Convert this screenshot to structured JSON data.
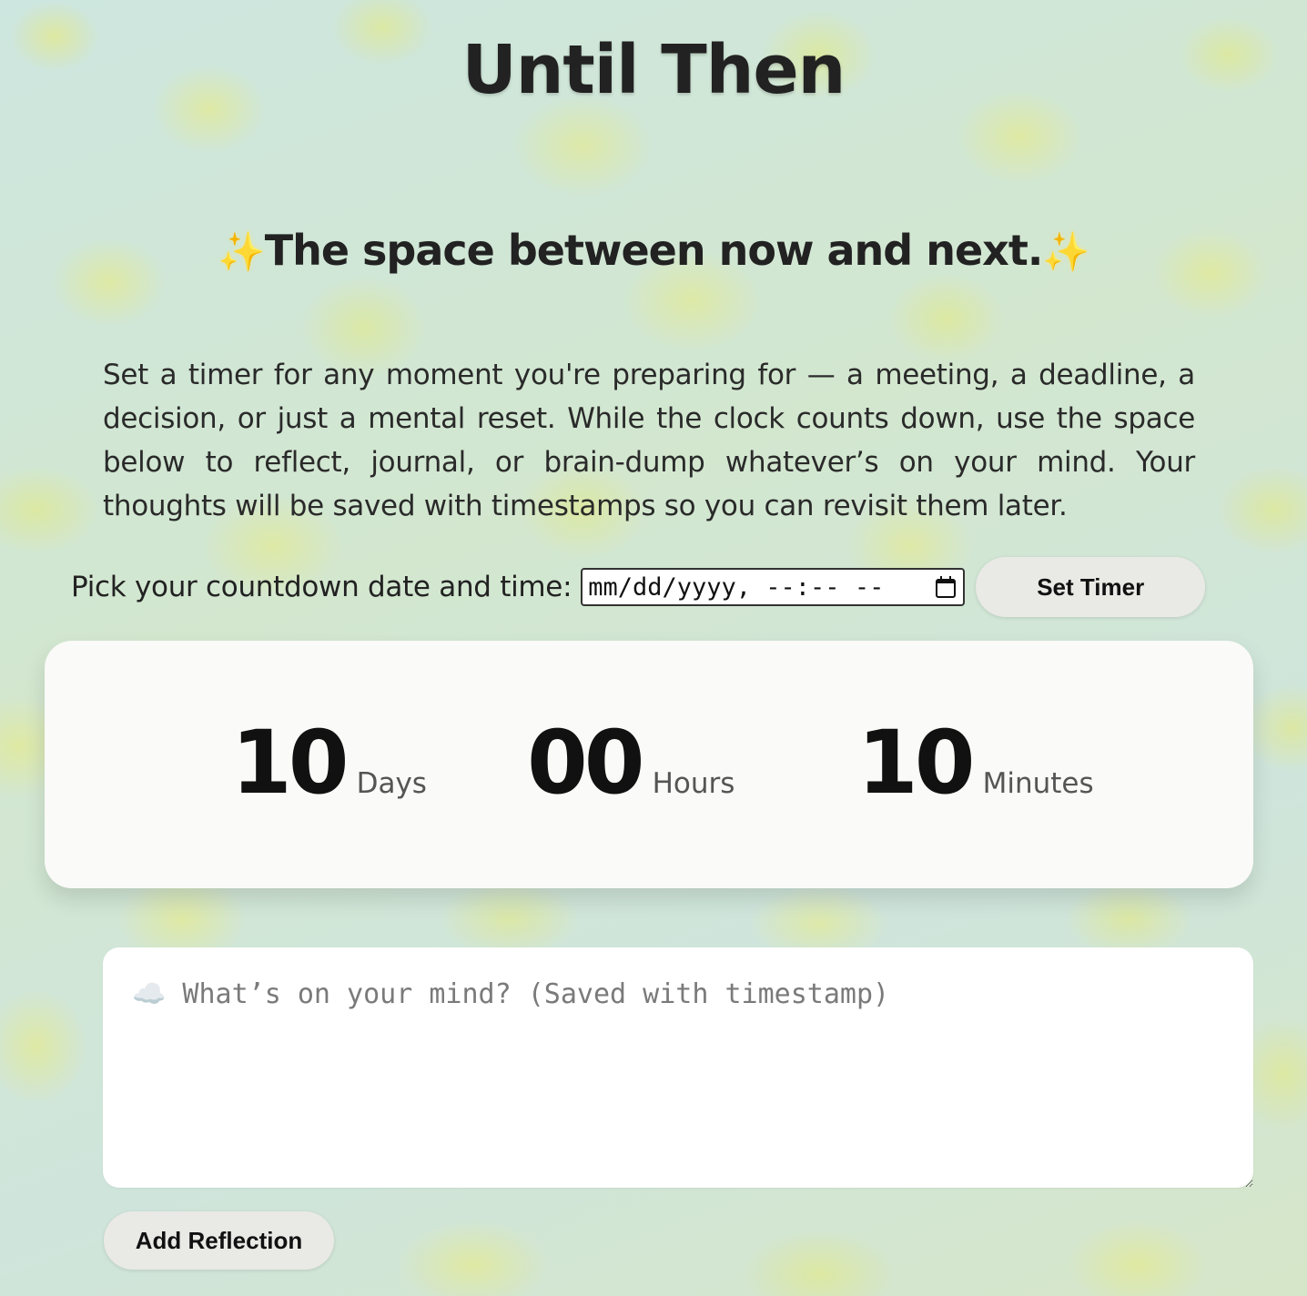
{
  "header": {
    "title": "Until Then",
    "subtitle_prefix": "✨",
    "subtitle": "The space between now and next.",
    "subtitle_suffix": "✨"
  },
  "intro": {
    "description": "Set a timer for any moment you're preparing for — a meeting, a deadline, a decision, or just a mental reset. While the clock counts down, use the space below to reflect, journal, or brain-dump whatever’s on your mind. Your thoughts will be saved with timestamps so you can revisit them later."
  },
  "picker": {
    "label": "Pick your countdown date and time:",
    "placeholder": "mm/dd/yyyy, --:-- --",
    "icon": "calendar-icon",
    "button_label": "Set Timer"
  },
  "countdown": {
    "days": {
      "value": "10",
      "label": "Days"
    },
    "hours": {
      "value": "00",
      "label": "Hours"
    },
    "minutes": {
      "value": "10",
      "label": "Minutes"
    }
  },
  "reflection": {
    "placeholder": "☁️ What’s on your mind? (Saved with timestamp)",
    "button_label": "Add Reflection"
  },
  "colors": {
    "card_background": "#fafaf8",
    "button_background": "#e9e9e6",
    "text": "#222222",
    "sparkle": "#f2c230"
  }
}
